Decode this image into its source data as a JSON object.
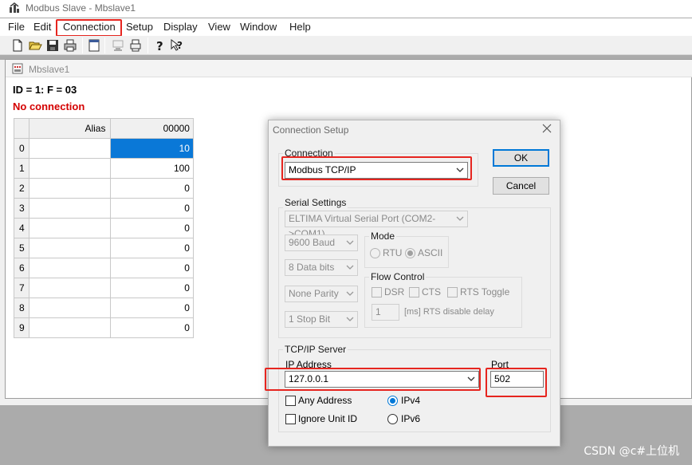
{
  "window": {
    "title": "Modbus Slave - Mbslave1"
  },
  "menu": [
    "File",
    "Edit",
    "Connection",
    "Setup",
    "Display",
    "View",
    "Window",
    "Help"
  ],
  "toolbar": [
    "new-icon",
    "open-icon",
    "save-icon",
    "print-icon",
    "window-icon",
    "monitor-icon",
    "printer-icon",
    "help-icon",
    "context-help-icon"
  ],
  "child": {
    "title": "Mbslave1",
    "id_line": "ID = 1: F = 03",
    "status": "No connection",
    "grid": {
      "headers": [
        "Alias",
        "00000"
      ],
      "rows": [
        {
          "index": "0",
          "alias": "",
          "value": "10"
        },
        {
          "index": "1",
          "alias": "",
          "value": "100"
        },
        {
          "index": "2",
          "alias": "",
          "value": "0"
        },
        {
          "index": "3",
          "alias": "",
          "value": "0"
        },
        {
          "index": "4",
          "alias": "",
          "value": "0"
        },
        {
          "index": "5",
          "alias": "",
          "value": "0"
        },
        {
          "index": "6",
          "alias": "",
          "value": "0"
        },
        {
          "index": "7",
          "alias": "",
          "value": "0"
        },
        {
          "index": "8",
          "alias": "",
          "value": "0"
        },
        {
          "index": "9",
          "alias": "",
          "value": "0"
        }
      ]
    }
  },
  "dialog": {
    "title": "Connection Setup",
    "connection_label": "Connection",
    "connection_value": "Modbus TCP/IP",
    "ok": "OK",
    "cancel": "Cancel",
    "serial": {
      "label": "Serial Settings",
      "port": "ELTIMA Virtual Serial Port (COM2->COM1)",
      "baud": "9600 Baud",
      "databits": "8 Data bits",
      "parity": "None Parity",
      "stopbit": "1 Stop Bit",
      "mode_label": "Mode",
      "rtu": "RTU",
      "ascii": "ASCII",
      "flow_label": "Flow Control",
      "dsr": "DSR",
      "cts": "CTS",
      "rts_toggle": "RTS Toggle",
      "rts_delay_value": "1",
      "rts_delay_label": "[ms] RTS disable delay"
    },
    "tcp": {
      "label": "TCP/IP Server",
      "ip_label": "IP Address",
      "ip_value": "127.0.0.1",
      "port_label": "Port",
      "port_value": "502",
      "any_address": "Any Address",
      "ignore_unit": "Ignore Unit ID",
      "ipv4": "IPv4",
      "ipv6": "IPv6"
    }
  },
  "watermark": "CSDN @c#上位机",
  "colors": {
    "highlight": "#e6251f",
    "selection": "#0a78d7",
    "status_red": "#d40000"
  }
}
